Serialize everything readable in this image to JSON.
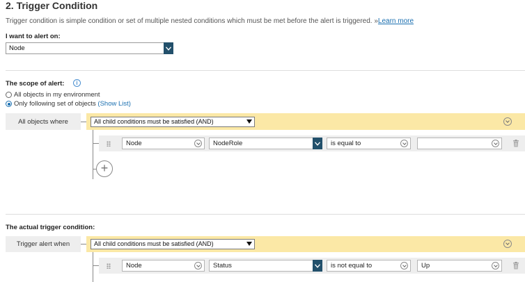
{
  "section": {
    "title": "2. Trigger Condition",
    "description": "Trigger condition is simple condition or set of multiple nested conditions which must be met before the alert is triggered.",
    "learn_more_prefix": "»",
    "learn_more": "Learn more"
  },
  "alert_on": {
    "label": "I want to alert on:",
    "value": "Node"
  },
  "scope": {
    "label": "The scope of alert:",
    "radio_all": "All objects in my environment",
    "radio_following": "Only following set of objects",
    "show_list": "(Show List)",
    "selected": "following",
    "group_label": "All objects where",
    "group_select": "All child conditions must be satisfied (AND)",
    "condition": {
      "object": "Node",
      "property": "NodeRole",
      "operator": "is equal to",
      "value": ""
    }
  },
  "trigger": {
    "label": "The actual trigger condition:",
    "group_label": "Trigger alert when",
    "group_select": "All child conditions must be satisfied (AND)",
    "condition": {
      "object": "Node",
      "property": "Status",
      "operator": "is not equal to",
      "value": "Up"
    }
  },
  "icons": {
    "info": "info-icon",
    "drag": "drag-handle-icon",
    "trash": "trash-icon",
    "add": "add-circle-icon",
    "collapse": "chevron-down-circle-icon"
  },
  "colors": {
    "accent": "#1a6fb0",
    "dropdown_button": "#22506b",
    "group_bar": "#fbe8a6",
    "row_bg": "#eeeeee"
  }
}
